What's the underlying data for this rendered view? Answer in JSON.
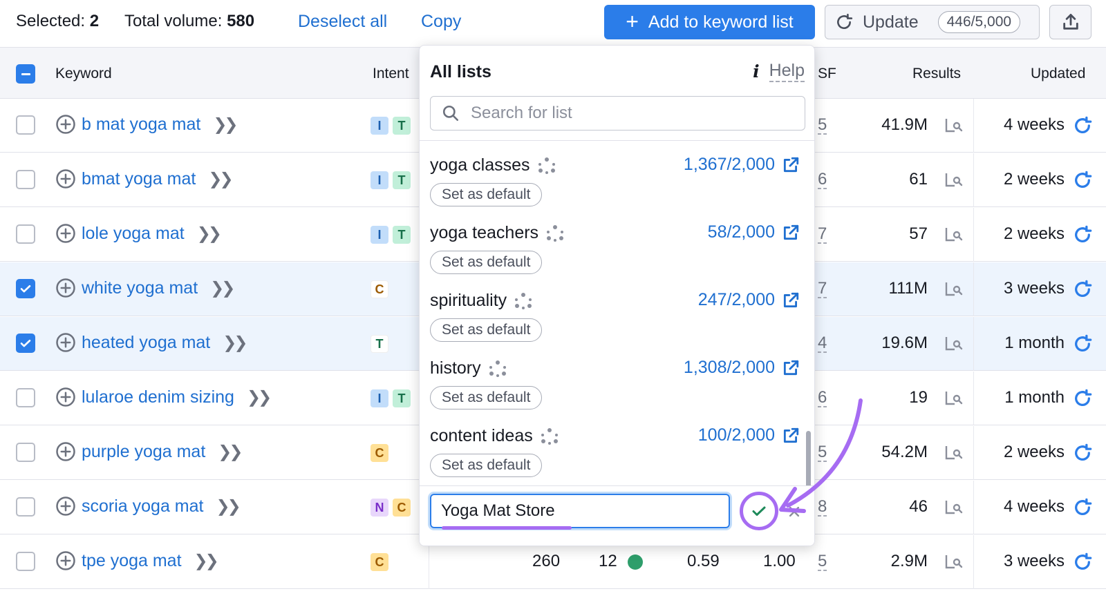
{
  "topbar": {
    "selected_label": "Selected:",
    "selected_count": "2",
    "volume_label": "Total volume:",
    "volume_value": "580",
    "deselect_label": "Deselect all",
    "copy_label": "Copy",
    "add_label": "Add to keyword list",
    "update_label": "Update",
    "update_counter": "446/5,000"
  },
  "table": {
    "headers": {
      "keyword": "Keyword",
      "intent": "Intent",
      "sf": "SF",
      "results": "Results",
      "updated": "Updated"
    },
    "rows": [
      {
        "keyword": "b mat yoga mat",
        "intent": [
          "I",
          "T"
        ],
        "sf": "5",
        "results": "41.9M",
        "updated": "4 weeks",
        "selected": false
      },
      {
        "keyword": "bmat yoga mat",
        "intent": [
          "I",
          "T"
        ],
        "sf": "6",
        "results": "61",
        "updated": "2 weeks",
        "selected": false
      },
      {
        "keyword": "lole yoga mat",
        "intent": [
          "I",
          "T"
        ],
        "sf": "7",
        "results": "57",
        "updated": "2 weeks",
        "selected": false
      },
      {
        "keyword": "white yoga mat",
        "intent": [
          "C"
        ],
        "sf": "7",
        "results": "111M",
        "updated": "3 weeks",
        "selected": true
      },
      {
        "keyword": "heated yoga mat",
        "intent": [
          "T"
        ],
        "sf": "4",
        "results": "19.6M",
        "updated": "1 month",
        "selected": true
      },
      {
        "keyword": "lularoe denim sizing",
        "intent": [
          "I",
          "T"
        ],
        "sf": "6",
        "results": "19",
        "updated": "1 month",
        "selected": false
      },
      {
        "keyword": "purple yoga mat",
        "intent": [
          "C"
        ],
        "sf": "5",
        "results": "54.2M",
        "updated": "2 weeks",
        "selected": false
      },
      {
        "keyword": "scoria yoga mat",
        "intent": [
          "N",
          "C"
        ],
        "sf": "8",
        "results": "46",
        "updated": "4 weeks",
        "selected": false
      },
      {
        "keyword": "tpe yoga mat",
        "intent": [
          "C"
        ],
        "sf": "5",
        "results": "2.9M",
        "updated": "3 weeks",
        "selected": false,
        "volume": "260",
        "kd": "12",
        "cpc": "0.59",
        "com": "1.00"
      }
    ]
  },
  "panel": {
    "title": "All lists",
    "help_label": "Help",
    "search_placeholder": "Search for list",
    "set_default_label": "Set as default",
    "lists": [
      {
        "name": "yoga classes",
        "count": "1,367/2,000"
      },
      {
        "name": "yoga teachers",
        "count": "58/2,000"
      },
      {
        "name": "spirituality",
        "count": "247/2,000"
      },
      {
        "name": "history",
        "count": "1,308/2,000"
      },
      {
        "name": "content ideas",
        "count": "100/2,000"
      }
    ],
    "new_list_value": "Yoga Mat Store"
  },
  "colors": {
    "accent": "#2b7de9",
    "annotation": "#a66cf2",
    "link": "#1f6fd0",
    "kd_dot": "#2e9e6b"
  }
}
